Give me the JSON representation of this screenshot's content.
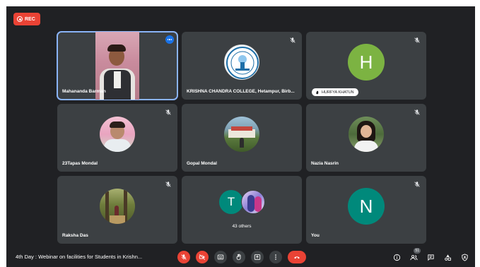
{
  "recording": {
    "label": "REC"
  },
  "tiles": [
    {
      "name": "Mahananda Barman"
    },
    {
      "name": "KRISHNA CHANDRA COLLEGE, Hetampur, Birb..."
    },
    {
      "name": "HURFYA KHATUN",
      "initial": "H",
      "color": "#7cb342"
    },
    {
      "name": "23Tapas Mondal"
    },
    {
      "name": "Gopal Mondal"
    },
    {
      "name": "Nazia Nasrin"
    },
    {
      "name": "Raksha Das"
    },
    {
      "others_label": "43 others",
      "initial": "T",
      "color": "#00897b"
    },
    {
      "name": "You",
      "initial": "N",
      "color": "#00897b"
    }
  ],
  "bottom": {
    "meeting_title": "4th Day : Webinar on facilities for Students in Krishn...",
    "participants_count": "51"
  },
  "icons": [
    "record-icon",
    "mic-off-icon",
    "camera-off-icon",
    "captions-icon",
    "raise-hand-icon",
    "present-icon",
    "more-icon",
    "end-call-icon",
    "info-icon",
    "people-icon",
    "chat-icon",
    "activities-icon",
    "host-controls-icon"
  ]
}
